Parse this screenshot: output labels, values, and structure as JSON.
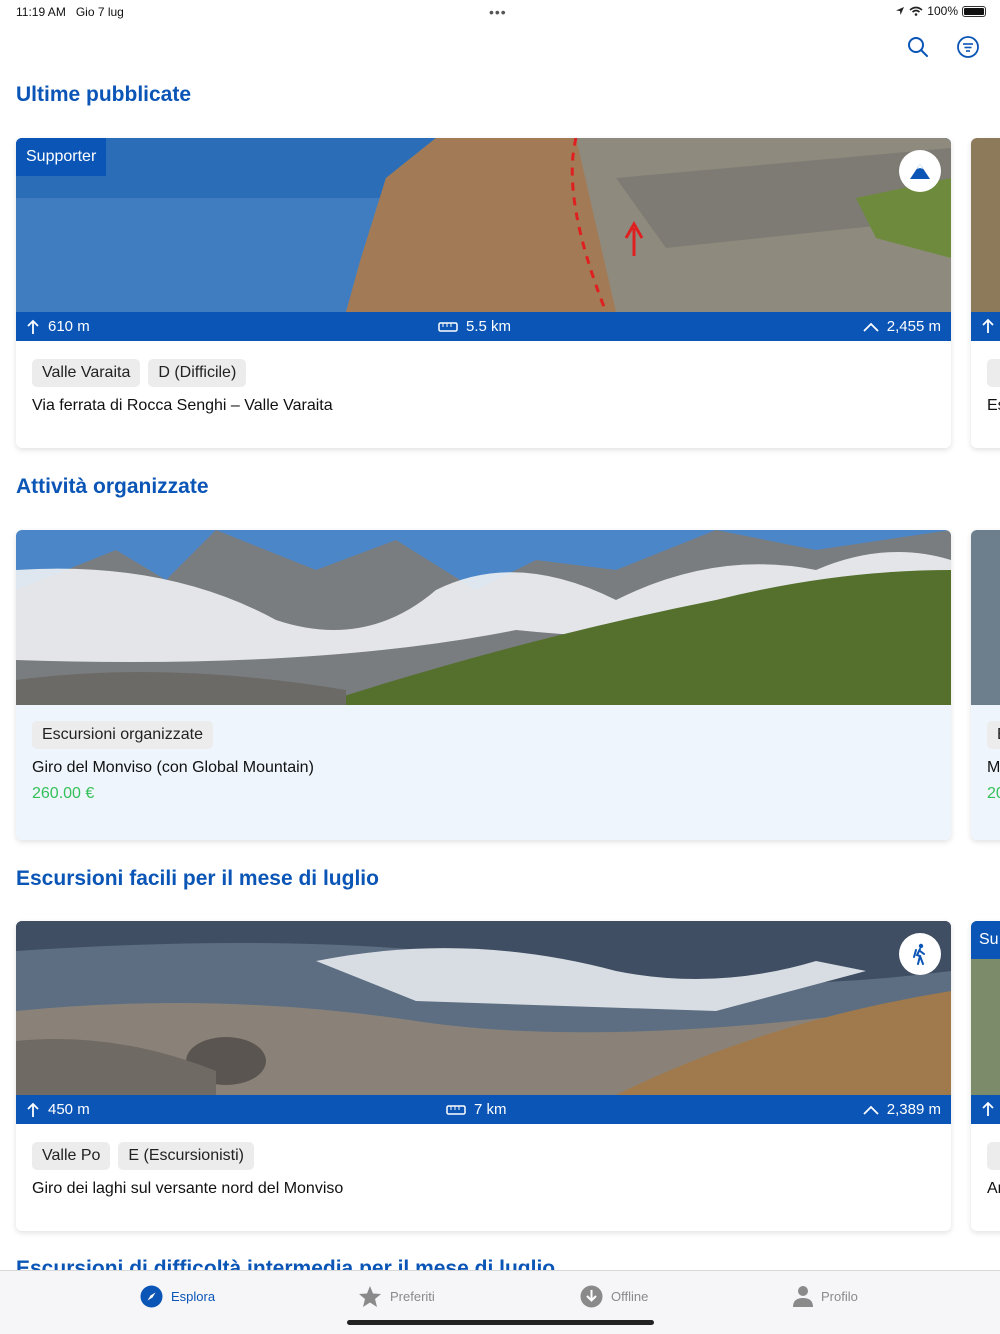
{
  "status": {
    "time": "11:19 AM",
    "date": "Gio 7 lug",
    "battery": "100%"
  },
  "toolbar": {
    "icons": [
      "search-icon",
      "filter-icon"
    ]
  },
  "sections": [
    {
      "title": "Ultime pubblicate"
    },
    {
      "title": "Attività organizzate"
    },
    {
      "title": "Escursioni facili per il mese di luglio"
    },
    {
      "title": "Escursioni di difficoltà intermedia per il mese di luglio"
    }
  ],
  "cards": {
    "ferrata": {
      "badge": "Supporter",
      "ascent": "610 m",
      "distance": "5.5 km",
      "altitude": "2,455 m",
      "tags": [
        "Valle Varaita",
        "D (Difficile)"
      ],
      "title": "Via ferrata di Rocca Senghi – Valle Varaita"
    },
    "monviso": {
      "tags": [
        "Escursioni organizzate"
      ],
      "title": "Giro del Monviso (con Global Mountain)",
      "price": "260.00 €"
    },
    "laghi": {
      "ascent": "450 m",
      "distance": "7 km",
      "altitude": "2,389 m",
      "tags": [
        "Valle Po",
        "E (Escursionisti)"
      ],
      "title": "Giro dei laghi sul versante nord del Monviso"
    },
    "peek": {
      "title1": "Es",
      "tag2": "E",
      "title2": "M",
      "price2": "20",
      "badge3": "Su",
      "title3": "Ar"
    }
  },
  "tabs": [
    {
      "label": "Esplora",
      "icon": "compass-icon"
    },
    {
      "label": "Preferiti",
      "icon": "star-icon"
    },
    {
      "label": "Offline",
      "icon": "download-icon"
    },
    {
      "label": "Profilo",
      "icon": "person-icon"
    }
  ],
  "colors": {
    "accent": "#0a55b6",
    "price": "#35c05a"
  }
}
